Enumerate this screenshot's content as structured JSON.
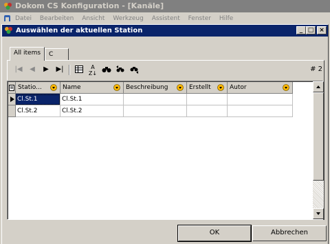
{
  "window": {
    "title": "Dokom CS Konfiguration - [Kanäle]"
  },
  "menu": {
    "items": [
      "Datei",
      "Bearbeiten",
      "Ansicht",
      "Werkzeug",
      "Assistent",
      "Fenster",
      "Hilfe"
    ]
  },
  "dialog": {
    "title": "Auswählen der aktuellen Station",
    "caption_buttons": {
      "minimize": "_",
      "maximize": "□",
      "close": "×"
    }
  },
  "tabs": [
    {
      "label": "All items"
    },
    {
      "label": "C"
    }
  ],
  "toolbar": {
    "icons": [
      "first-record-icon",
      "prev-record-icon",
      "next-record-icon",
      "last-record-icon",
      "grid-view-icon",
      "sort-az-icon",
      "find-icon",
      "find-next-icon",
      "find-prev-icon"
    ],
    "record_count": "# 2"
  },
  "grid": {
    "columns": [
      "Statio...",
      "Name",
      "Beschreibung",
      "Erstellt",
      "Autor"
    ],
    "rows": [
      {
        "station": "Cl.St.1",
        "name": "Cl.St.1",
        "beschreibung": "",
        "erstellt": "",
        "autor": ""
      },
      {
        "station": "Cl.St.2",
        "name": "Cl.St.2",
        "beschreibung": "",
        "erstellt": "",
        "autor": ""
      }
    ]
  },
  "buttons": {
    "ok": "OK",
    "cancel": "Abbrechen"
  },
  "colors": {
    "active_title": "#0a246a",
    "inactive_title": "#808080",
    "face": "#d4d0c8",
    "accent": "#ffb800"
  }
}
